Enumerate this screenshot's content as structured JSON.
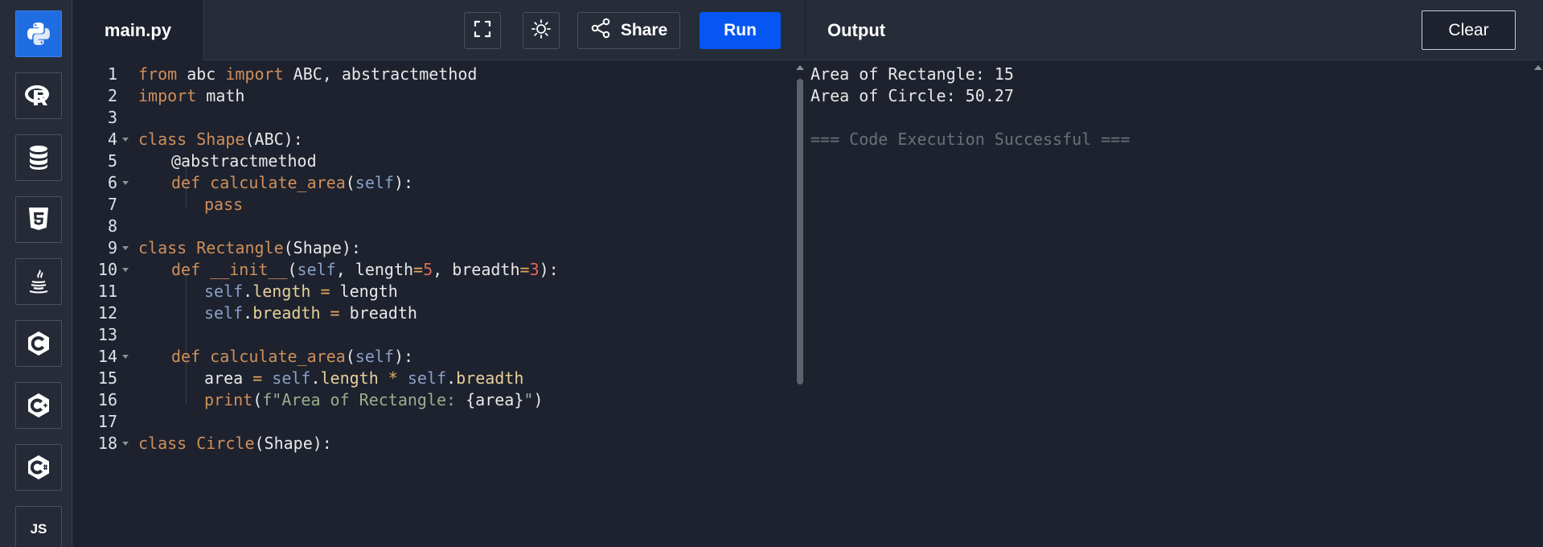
{
  "sidebar": {
    "languages": [
      {
        "icon": "python-icon",
        "active": true
      },
      {
        "icon": "r-icon",
        "active": false
      },
      {
        "icon": "sql-icon",
        "active": false
      },
      {
        "icon": "html5-icon",
        "active": false
      },
      {
        "icon": "java-icon",
        "active": false
      },
      {
        "icon": "c-icon",
        "active": false
      },
      {
        "icon": "cpp-icon",
        "active": false
      },
      {
        "icon": "csharp-icon",
        "active": false
      },
      {
        "icon": "javascript-icon",
        "label": "JS",
        "active": false
      }
    ]
  },
  "editor": {
    "file_name": "main.py",
    "share_label": "Share",
    "run_label": "Run",
    "lines": [
      {
        "n": "1"
      },
      {
        "n": "2"
      },
      {
        "n": "3"
      },
      {
        "n": "4"
      },
      {
        "n": "5"
      },
      {
        "n": "6"
      },
      {
        "n": "7"
      },
      {
        "n": "8"
      },
      {
        "n": "9"
      },
      {
        "n": "10"
      },
      {
        "n": "11"
      },
      {
        "n": "12"
      },
      {
        "n": "13"
      },
      {
        "n": "14"
      },
      {
        "n": "15"
      },
      {
        "n": "16"
      },
      {
        "n": "17"
      },
      {
        "n": "18"
      }
    ],
    "code": {
      "l1": {
        "from": "from",
        "mod": " abc ",
        "import": "import",
        "rest": " ABC, abstractmethod"
      },
      "l2": {
        "import": "import",
        "rest": " math"
      },
      "l4": {
        "class": "class",
        "sp": " ",
        "name": "Shape",
        "rest": "(ABC):"
      },
      "l5": {
        "dec": "@abstractmethod"
      },
      "l6": {
        "def": "def",
        "sp": " ",
        "name": "calculate_area",
        "p1": "(",
        "self": "self",
        "p2": "):"
      },
      "l7": {
        "pass": "pass"
      },
      "l9": {
        "class": "class",
        "sp": " ",
        "name": "Rectangle",
        "rest": "(Shape):"
      },
      "l10": {
        "def": "def",
        "sp": " ",
        "name": "__init__",
        "p1": "(",
        "self": "self",
        "a": ", length",
        "eq1": "=",
        "v1": "5",
        "b": ", breadth",
        "eq2": "=",
        "v2": "3",
        "c": "):"
      },
      "l11": {
        "self": "self",
        "dot": ".",
        "attr": "length",
        "eq": " = ",
        "rest": "length"
      },
      "l12": {
        "self": "self",
        "dot": ".",
        "attr": "breadth",
        "eq": " = ",
        "rest": "breadth"
      },
      "l14": {
        "def": "def",
        "sp": " ",
        "name": "calculate_area",
        "p1": "(",
        "self": "self",
        "p2": "):"
      },
      "l15": {
        "a": "area",
        "eq": " = ",
        "self1": "self",
        "dot1": ".",
        "attr1": "length",
        "mul": " * ",
        "self2": "self",
        "dot2": ".",
        "attr2": "breadth"
      },
      "l16": {
        "fn": "print",
        "p1": "(",
        "f": "f\"Area of Rectangle: ",
        "br": "{area}",
        "q": "\"",
        "p2": ")"
      },
      "l18": {
        "class": "class",
        "sp": " ",
        "name": "Circle",
        "rest": "(Shape):"
      }
    }
  },
  "output": {
    "title": "Output",
    "clear_label": "Clear",
    "lines": [
      "Area of Rectangle: 15",
      "Area of Circle: 50.27",
      "",
      "=== Code Execution Successful ==="
    ]
  },
  "colors": {
    "accent": "#0556f3",
    "active_language": "#1f6de0",
    "background": "#1d222e",
    "keyword": "#d08f5a"
  }
}
